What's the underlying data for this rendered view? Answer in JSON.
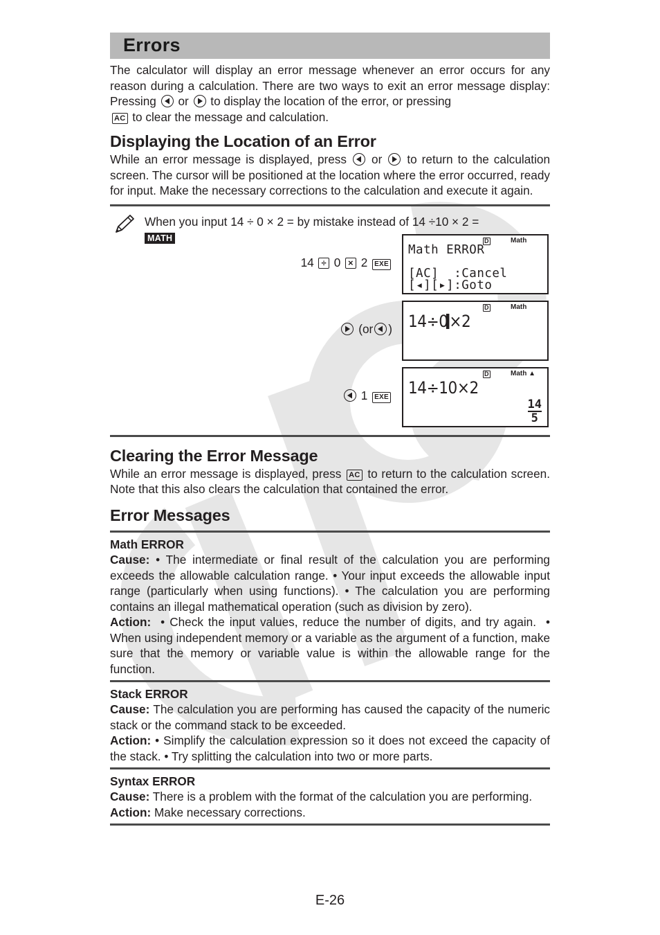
{
  "section": {
    "title": "Errors",
    "intro": {
      "part1": "The calculator will display an error message whenever an error occurs for any reason during a calculation. There are two ways to exit an error message display: Pressing",
      "or": "or",
      "part2": "to display the location of the error, or pressing",
      "part3": "to clear the message and calculation."
    }
  },
  "keys": {
    "left_arrow": "left-arrow-key",
    "right_arrow": "right-arrow-key",
    "ac": "AC",
    "exe": "EXE",
    "divide": "÷",
    "multiply": "×"
  },
  "displaying": {
    "heading": "Displaying the Location of an Error",
    "part1": "While an error message is displayed, press",
    "or": "or",
    "part2": "to return to the calculation screen. The cursor will be positioned at the location where the error occurred, ready for input. Make the necessary corrections to the calculation and execute it again."
  },
  "example": {
    "intro": "When you input 14 ÷ 0 × 2 = by mistake instead of 14 ÷10 × 2 =",
    "mode_badge": "MATH",
    "steps": [
      {
        "keys": {
          "n1": "14",
          "n2": "0",
          "n3": "2"
        },
        "screen": {
          "indicator_d": "D",
          "indicator_mode": "Math",
          "line1": "Math ERROR",
          "line3": "[AC]  :Cancel",
          "line4": "[◂][▸]:Goto"
        }
      },
      {
        "keys": {
          "or_text": "(or",
          "close": ")"
        },
        "screen": {
          "indicator_d": "D",
          "indicator_mode": "Math",
          "expr_before": "14÷0",
          "expr_after": "×2"
        }
      },
      {
        "keys": {
          "n1": "1"
        },
        "screen": {
          "indicator_d": "D",
          "indicator_mode": "Math ▲",
          "expr": "14÷10×2",
          "result_numerator": "14",
          "result_denominator": "5"
        }
      }
    ]
  },
  "clearing": {
    "heading": "Clearing the Error Message",
    "part1": "While an error message is displayed, press",
    "part2": "to return to the calculation screen. Note that this also clears the calculation that contained the error."
  },
  "messages": {
    "heading": "Error Messages",
    "cause_label": "Cause:",
    "action_label": "Action:",
    "items": [
      {
        "title": "Math ERROR",
        "cause": " • The intermediate or final result of the calculation you are performing exceeds the allowable calculation range.  • Your input exceeds the allowable input range (particularly when using functions).  • The calculation you are performing contains an illegal mathematical operation (such as division by zero).",
        "action": "  • Check the input values, reduce the number of digits, and try again.  • When using independent memory or a variable as the argument of a function, make sure that the memory or variable value is within the allowable range for the function."
      },
      {
        "title": "Stack ERROR",
        "cause": "  The calculation you are performing has caused the capacity of the numeric stack or the command stack to be exceeded.",
        "action": "  • Simplify the calculation expression so it does not exceed the capacity of the stack.  • Try splitting the calculation into two or more parts."
      },
      {
        "title": "Syntax ERROR",
        "cause": " There is a problem with the format of the calculation you are performing.",
        "action": "  Make necessary corrections."
      }
    ]
  },
  "footer": {
    "page_number": "E-26"
  },
  "watermark": {
    "text": "CASIO"
  }
}
